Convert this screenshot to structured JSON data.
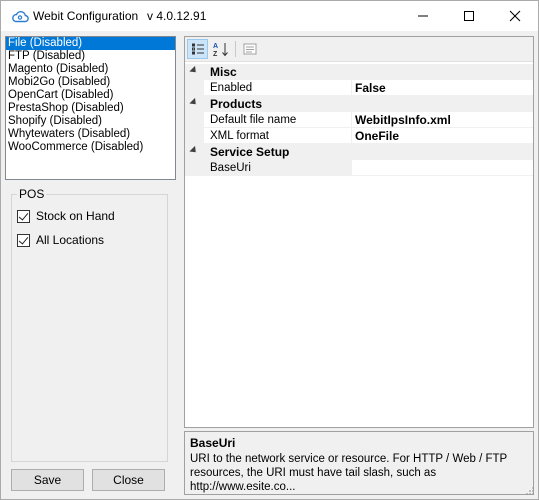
{
  "window": {
    "title": "Webit Configuration",
    "version": "v 4.0.12.91",
    "minimize_glyph": "—",
    "maximize_glyph": "☐",
    "close_glyph": "✕"
  },
  "connectors": [
    "File (Disabled)",
    "FTP (Disabled)",
    "Magento (Disabled)",
    "Mobi2Go (Disabled)",
    "OpenCart (Disabled)",
    "PrestaShop (Disabled)",
    "Shopify (Disabled)",
    "Whytewaters (Disabled)",
    "WooCommerce (Disabled)"
  ],
  "selected_connector": "File (Disabled)",
  "pos": {
    "group_label": "POS",
    "stock_on_hand": {
      "label": "Stock on Hand",
      "checked": true
    },
    "all_locations": {
      "label": "All Locations",
      "checked": true
    }
  },
  "buttons": {
    "save": "Save",
    "close": "Close"
  },
  "property_grid": {
    "categories": [
      {
        "name": "Misc",
        "props": [
          {
            "name": "Enabled",
            "value": "False",
            "bold": true
          }
        ]
      },
      {
        "name": "Products",
        "props": [
          {
            "name": "Default file name",
            "value": "WebitIpsInfo.xml",
            "bold": true
          },
          {
            "name": "XML format",
            "value": "OneFile",
            "bold": true
          }
        ]
      },
      {
        "name": "Service Setup",
        "props": [
          {
            "name": "BaseUri",
            "value": "",
            "bold": false
          }
        ]
      }
    ],
    "help": {
      "title": "BaseUri",
      "description": "URI to the network service or resource. For HTTP / Web / FTP resources, the URI must have tail slash, such as http://www.esite.co..."
    }
  },
  "colors": {
    "selection": "#0078d7",
    "toolbar_active": "#cce4f7"
  }
}
